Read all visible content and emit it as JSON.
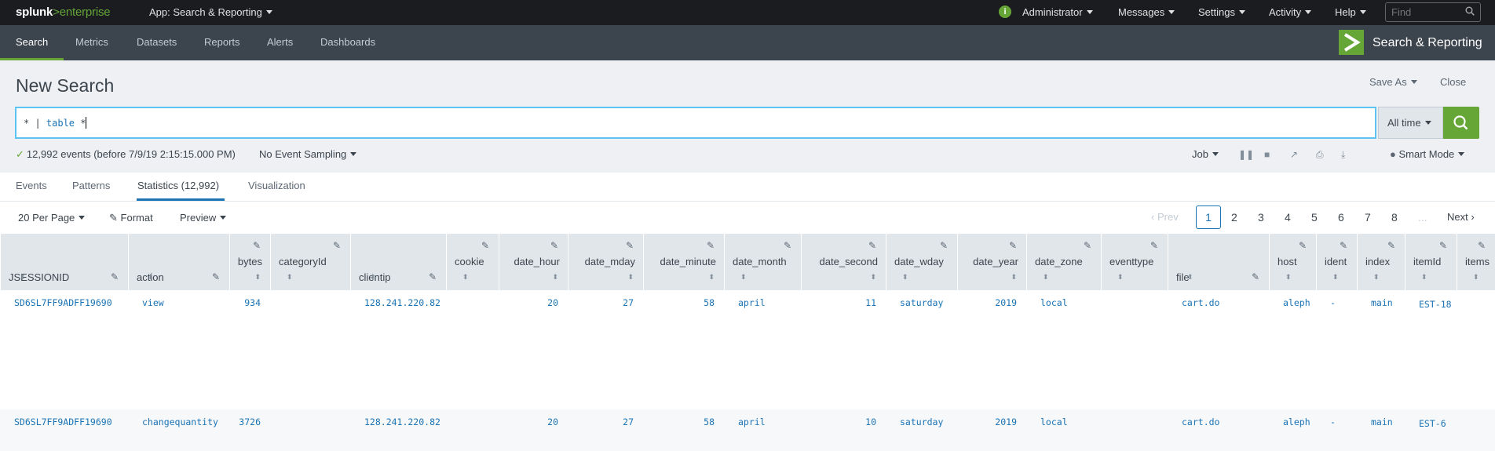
{
  "topbar": {
    "logo_a": "splunk",
    "logo_b": ">",
    "logo_c": "enterprise",
    "app": "App: Search & Reporting",
    "menus": [
      "Administrator",
      "Messages",
      "Settings",
      "Activity",
      "Help"
    ],
    "info_icon": "i",
    "find_placeholder": "Find"
  },
  "nav": {
    "items": [
      "Search",
      "Metrics",
      "Datasets",
      "Reports",
      "Alerts",
      "Dashboards"
    ],
    "app_title": "Search & Reporting"
  },
  "header": {
    "title": "New Search",
    "save_as": "Save As",
    "close": "Close",
    "query_a": "* | ",
    "query_b": "table",
    "query_c": " *",
    "time_range": "All time",
    "status_text": "12,992 events (before 7/9/19 2:15:15.000 PM)",
    "sampling": "No Event Sampling",
    "job": "Job",
    "mode": "Smart Mode"
  },
  "tabs": [
    "Events",
    "Patterns",
    "Statistics (12,992)",
    "Visualization"
  ],
  "toolbar": {
    "per_page": "20 Per Page",
    "format": "Format",
    "preview": "Preview"
  },
  "pager": {
    "prev": "Prev",
    "pages": [
      "1",
      "2",
      "3",
      "4",
      "5",
      "6",
      "7",
      "8"
    ],
    "ellipsis": "...",
    "next": "Next"
  },
  "table": {
    "columns": [
      "JSESSIONID",
      "action",
      "bytes",
      "categoryId",
      "clientip",
      "cookie",
      "date_hour",
      "date_mday",
      "date_minute",
      "date_month",
      "date_second",
      "date_wday",
      "date_year",
      "date_zone",
      "eventtype",
      "file",
      "host",
      "ident",
      "index",
      "itemId",
      "items"
    ],
    "rows": [
      [
        "SD6SL7FF9ADFF19690",
        "view",
        "934",
        "",
        "128.241.220.82",
        "",
        "20",
        "27",
        "58",
        "april",
        "11",
        "saturday",
        "2019",
        "local",
        "",
        "cart.do",
        "aleph",
        "-",
        "main",
        "EST-18",
        ""
      ],
      [
        "SD6SL7FF9ADFF19690",
        "changequantity",
        "3726",
        "",
        "128.241.220.82",
        "",
        "20",
        "27",
        "58",
        "april",
        "10",
        "saturday",
        "2019",
        "local",
        "",
        "cart.do",
        "aleph",
        "-",
        "main",
        "EST-6",
        ""
      ]
    ]
  },
  "colors": {
    "accent_green": "#65a637",
    "link_blue": "#1a73b4",
    "topbar_bg": "#1a1c20",
    "navbar_bg": "#3c444d"
  }
}
